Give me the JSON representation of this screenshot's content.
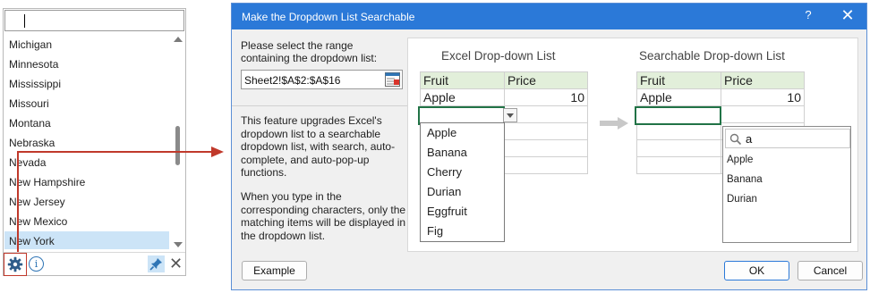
{
  "list_panel": {
    "search_value": "",
    "items": [
      "Michigan",
      "Minnesota",
      "Mississippi",
      "Missouri",
      "Montana",
      "Nebraska",
      "Nevada",
      "New Hampshire",
      "New Jersey",
      "New Mexico",
      "New York"
    ],
    "selected": "New York",
    "footer_icons": [
      "gear-icon",
      "info-icon",
      "pin-icon",
      "close-icon"
    ]
  },
  "dialog": {
    "title": "Make the Dropdown List Searchable",
    "help_label": "?",
    "close_label": "✕",
    "range_label": "Please select the range containing the dropdown list:",
    "range_value": "Sheet2!$A$2:$A$16",
    "description_1": "This feature upgrades Excel's dropdown list to a searchable dropdown list, with search, auto-complete, and auto-pop-up functions.",
    "description_2": "When you type in the corresponding characters, only the matching items will be displayed in the dropdown list.",
    "preview": {
      "excel_heading": "Excel Drop-down List",
      "searchable_heading": "Searchable Drop-down List",
      "col_fruit": "Fruit",
      "col_price": "Price",
      "row_fruit": "Apple",
      "row_price": "10",
      "excel_dropdown_items": [
        "Apple",
        "Banana",
        "Cherry",
        "Durian",
        "Eggfruit",
        "Fig"
      ],
      "search_query": "a",
      "search_results": [
        "Apple",
        "Banana",
        "Durian"
      ]
    },
    "buttons": {
      "example": "Example",
      "ok": "OK",
      "cancel": "Cancel"
    },
    "colors": {
      "titlebar": "#2b79d8",
      "header_fill": "#e2efda",
      "active_cell_border": "#217346",
      "highlight_annotation": "#c0392b"
    }
  }
}
